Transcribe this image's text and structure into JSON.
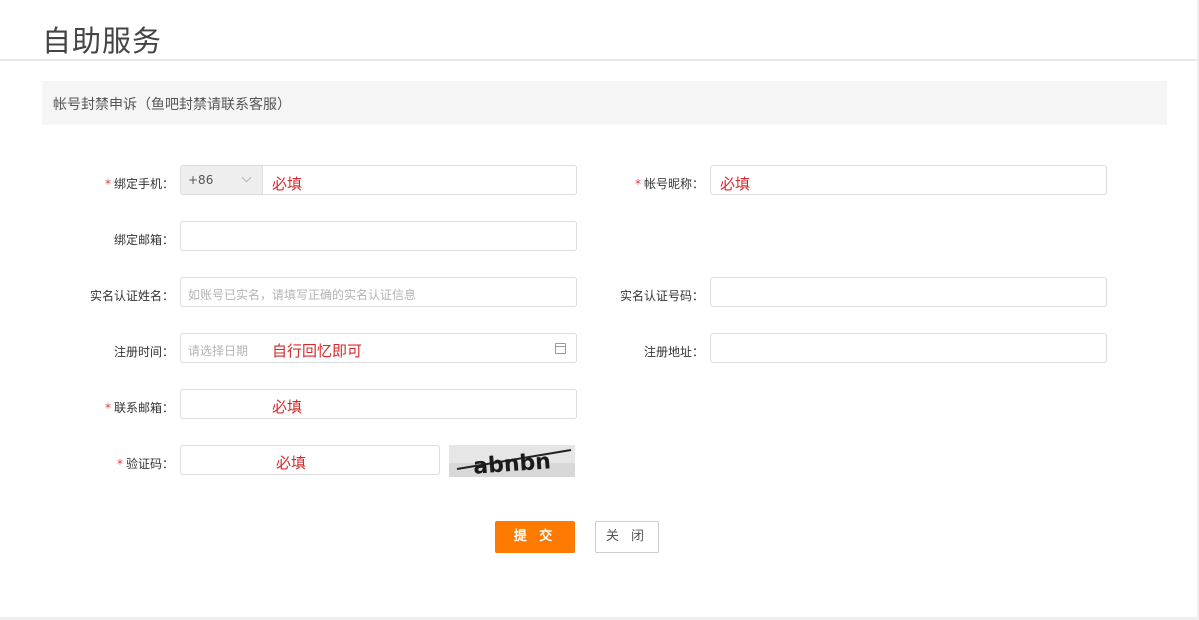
{
  "page": {
    "title": "自助服务"
  },
  "section": {
    "title": "帐号封禁申诉（鱼吧封禁请联系客服）"
  },
  "form": {
    "phone": {
      "label": "绑定手机：",
      "required": true,
      "prefix": "+86",
      "hint": "必填"
    },
    "nickname": {
      "label": "帐号昵称：",
      "required": true,
      "hint": "必填"
    },
    "bind_email": {
      "label": "绑定邮箱：",
      "required": false
    },
    "real_name": {
      "label": "实名认证姓名：",
      "required": false,
      "placeholder": "如账号已实名，请填写正确的实名认证信息"
    },
    "id_number": {
      "label": "实名认证号码：",
      "required": false
    },
    "reg_time": {
      "label": "注册时间：",
      "required": false,
      "placeholder": "请选择日期",
      "hint": "自行回忆即可"
    },
    "reg_address": {
      "label": "注册地址：",
      "required": false
    },
    "contact_email": {
      "label": "联系邮箱：",
      "required": true,
      "hint": "必填"
    },
    "captcha": {
      "label": "验证码：",
      "required": true,
      "hint": "必填",
      "image_text": "abnbn"
    }
  },
  "buttons": {
    "submit": "提 交",
    "close": "关 闭"
  },
  "colors": {
    "accent": "#ff7a00",
    "required_star": "#e4393c",
    "hint": "#d62a2a"
  },
  "icons": {
    "dropdown": "chevron-down-icon",
    "date": "calendar-icon"
  }
}
